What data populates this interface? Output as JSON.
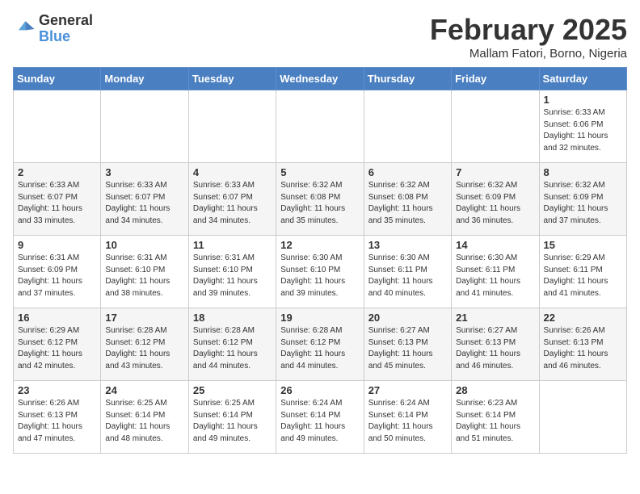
{
  "header": {
    "logo_general": "General",
    "logo_blue": "Blue",
    "month_title": "February 2025",
    "location": "Mallam Fatori, Borno, Nigeria"
  },
  "weekdays": [
    "Sunday",
    "Monday",
    "Tuesday",
    "Wednesday",
    "Thursday",
    "Friday",
    "Saturday"
  ],
  "weeks": [
    [
      {
        "day": "",
        "info": ""
      },
      {
        "day": "",
        "info": ""
      },
      {
        "day": "",
        "info": ""
      },
      {
        "day": "",
        "info": ""
      },
      {
        "day": "",
        "info": ""
      },
      {
        "day": "",
        "info": ""
      },
      {
        "day": "1",
        "info": "Sunrise: 6:33 AM\nSunset: 6:06 PM\nDaylight: 11 hours\nand 32 minutes."
      }
    ],
    [
      {
        "day": "2",
        "info": "Sunrise: 6:33 AM\nSunset: 6:07 PM\nDaylight: 11 hours\nand 33 minutes."
      },
      {
        "day": "3",
        "info": "Sunrise: 6:33 AM\nSunset: 6:07 PM\nDaylight: 11 hours\nand 34 minutes."
      },
      {
        "day": "4",
        "info": "Sunrise: 6:33 AM\nSunset: 6:07 PM\nDaylight: 11 hours\nand 34 minutes."
      },
      {
        "day": "5",
        "info": "Sunrise: 6:32 AM\nSunset: 6:08 PM\nDaylight: 11 hours\nand 35 minutes."
      },
      {
        "day": "6",
        "info": "Sunrise: 6:32 AM\nSunset: 6:08 PM\nDaylight: 11 hours\nand 35 minutes."
      },
      {
        "day": "7",
        "info": "Sunrise: 6:32 AM\nSunset: 6:09 PM\nDaylight: 11 hours\nand 36 minutes."
      },
      {
        "day": "8",
        "info": "Sunrise: 6:32 AM\nSunset: 6:09 PM\nDaylight: 11 hours\nand 37 minutes."
      }
    ],
    [
      {
        "day": "9",
        "info": "Sunrise: 6:31 AM\nSunset: 6:09 PM\nDaylight: 11 hours\nand 37 minutes."
      },
      {
        "day": "10",
        "info": "Sunrise: 6:31 AM\nSunset: 6:10 PM\nDaylight: 11 hours\nand 38 minutes."
      },
      {
        "day": "11",
        "info": "Sunrise: 6:31 AM\nSunset: 6:10 PM\nDaylight: 11 hours\nand 39 minutes."
      },
      {
        "day": "12",
        "info": "Sunrise: 6:30 AM\nSunset: 6:10 PM\nDaylight: 11 hours\nand 39 minutes."
      },
      {
        "day": "13",
        "info": "Sunrise: 6:30 AM\nSunset: 6:11 PM\nDaylight: 11 hours\nand 40 minutes."
      },
      {
        "day": "14",
        "info": "Sunrise: 6:30 AM\nSunset: 6:11 PM\nDaylight: 11 hours\nand 41 minutes."
      },
      {
        "day": "15",
        "info": "Sunrise: 6:29 AM\nSunset: 6:11 PM\nDaylight: 11 hours\nand 41 minutes."
      }
    ],
    [
      {
        "day": "16",
        "info": "Sunrise: 6:29 AM\nSunset: 6:12 PM\nDaylight: 11 hours\nand 42 minutes."
      },
      {
        "day": "17",
        "info": "Sunrise: 6:28 AM\nSunset: 6:12 PM\nDaylight: 11 hours\nand 43 minutes."
      },
      {
        "day": "18",
        "info": "Sunrise: 6:28 AM\nSunset: 6:12 PM\nDaylight: 11 hours\nand 44 minutes."
      },
      {
        "day": "19",
        "info": "Sunrise: 6:28 AM\nSunset: 6:12 PM\nDaylight: 11 hours\nand 44 minutes."
      },
      {
        "day": "20",
        "info": "Sunrise: 6:27 AM\nSunset: 6:13 PM\nDaylight: 11 hours\nand 45 minutes."
      },
      {
        "day": "21",
        "info": "Sunrise: 6:27 AM\nSunset: 6:13 PM\nDaylight: 11 hours\nand 46 minutes."
      },
      {
        "day": "22",
        "info": "Sunrise: 6:26 AM\nSunset: 6:13 PM\nDaylight: 11 hours\nand 46 minutes."
      }
    ],
    [
      {
        "day": "23",
        "info": "Sunrise: 6:26 AM\nSunset: 6:13 PM\nDaylight: 11 hours\nand 47 minutes."
      },
      {
        "day": "24",
        "info": "Sunrise: 6:25 AM\nSunset: 6:14 PM\nDaylight: 11 hours\nand 48 minutes."
      },
      {
        "day": "25",
        "info": "Sunrise: 6:25 AM\nSunset: 6:14 PM\nDaylight: 11 hours\nand 49 minutes."
      },
      {
        "day": "26",
        "info": "Sunrise: 6:24 AM\nSunset: 6:14 PM\nDaylight: 11 hours\nand 49 minutes."
      },
      {
        "day": "27",
        "info": "Sunrise: 6:24 AM\nSunset: 6:14 PM\nDaylight: 11 hours\nand 50 minutes."
      },
      {
        "day": "28",
        "info": "Sunrise: 6:23 AM\nSunset: 6:14 PM\nDaylight: 11 hours\nand 51 minutes."
      },
      {
        "day": "",
        "info": ""
      }
    ]
  ]
}
